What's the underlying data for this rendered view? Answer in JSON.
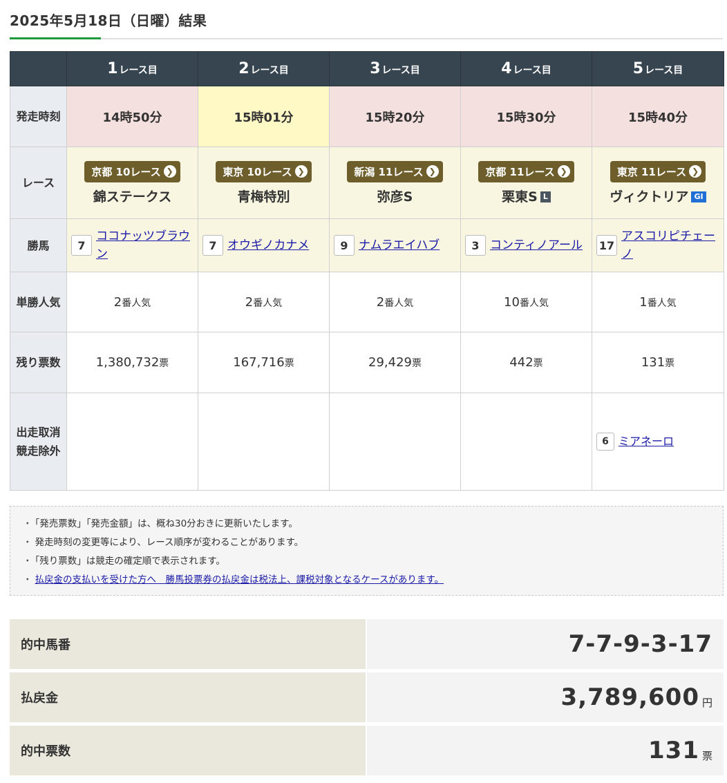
{
  "page": {
    "title": "2025年5月18日（日曜）結果"
  },
  "table": {
    "row_labels": {
      "time": "発走時刻",
      "race": "レース",
      "winner": "勝馬",
      "popularity": "単勝人気",
      "votes": "残り票数",
      "scratch": "出走取消 競走除外"
    },
    "column_unit": "レース目",
    "popularity_unit": "番人気",
    "votes_unit": "票",
    "races": [
      {
        "num": "1",
        "time": "14時50分",
        "time_highlight": false,
        "venue": "京都 10レース",
        "name": "錦ステークス",
        "grade": "",
        "winner_num": "7",
        "winner_name": "ココナッツブラウン",
        "popularity": "2",
        "votes": "1,380,732"
      },
      {
        "num": "2",
        "time": "15時01分",
        "time_highlight": true,
        "venue": "東京 10レース",
        "name": "青梅特別",
        "grade": "",
        "winner_num": "7",
        "winner_name": "オウギノカナメ",
        "popularity": "2",
        "votes": "167,716"
      },
      {
        "num": "3",
        "time": "15時20分",
        "time_highlight": false,
        "venue": "新潟 11レース",
        "name": "弥彦S",
        "grade": "",
        "winner_num": "9",
        "winner_name": "ナムラエイハブ",
        "popularity": "2",
        "votes": "29,429"
      },
      {
        "num": "4",
        "time": "15時30分",
        "time_highlight": false,
        "venue": "京都 11レース",
        "name": "栗東S",
        "grade": "L",
        "winner_num": "3",
        "winner_name": "コンティノアール",
        "popularity": "10",
        "votes": "442"
      },
      {
        "num": "5",
        "time": "15時40分",
        "time_highlight": false,
        "venue": "東京 11レース",
        "name": "ヴィクトリア",
        "grade": "GI",
        "winner_num": "17",
        "winner_name": "アスコリピチェーノ",
        "popularity": "1",
        "votes": "131"
      }
    ],
    "scratch": {
      "race_index": 4,
      "num": "6",
      "name": "ミアネーロ"
    }
  },
  "notes": [
    "「発売票数」「発売金額」は、概ね30分おきに更新いたします。",
    "発走時刻の変更等により、レース順序が変わることがあります。",
    "「残り票数」は競走の確定順で表示されます。"
  ],
  "notes_link": "払戻金の支払いを受けた方へ　勝馬投票券の払戻金は税法上、課税対象となるケースがあります。",
  "summary": {
    "winning_label": "的中馬番",
    "winning_value": "7-7-9-3-17",
    "payout_label": "払戻金",
    "payout_value": "3,789,600",
    "payout_unit": "円",
    "tickets_label": "的中票数",
    "tickets_value": "131",
    "tickets_unit": "票"
  },
  "colors": {
    "header_bg": "#374550",
    "time_pink": "#f4e0df",
    "time_yellow": "#fff9c6",
    "race_bg": "#f8f5e1",
    "badge_bg": "#6d5e2c",
    "link": "#1a1aa8",
    "accent": "#1f9b3a"
  }
}
